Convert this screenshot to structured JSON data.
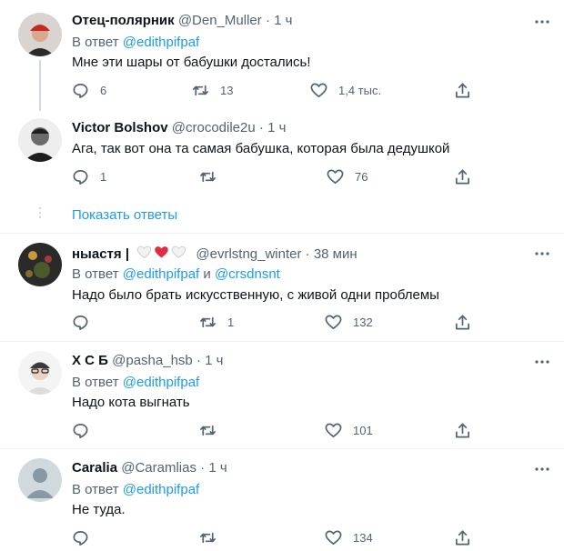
{
  "tweets": [
    {
      "name": "Отец-полярник",
      "handle": "@Den_Muller",
      "time": "1 ч",
      "reply_prefix": "В ответ",
      "reply_to": [
        "@edithpifpaf"
      ],
      "text": "Мне эти шары от бабушки достались!",
      "replies": "6",
      "retweets": "13",
      "likes": "1,4 тыс."
    },
    {
      "name": "Victor Bolshov",
      "handle": "@crocodile2u",
      "time": "1 ч",
      "text": "Ага, так вот она та самая бабушка, которая была дедушкой",
      "replies": "1",
      "retweets": "",
      "likes": "76"
    },
    {
      "name": "ныастя |",
      "name_emoji": [
        "white-heart",
        "red-heart",
        "white-heart"
      ],
      "handle": "@evrlstng_winter",
      "time": "38 мин",
      "reply_prefix": "В ответ",
      "reply_to": [
        "@edithpifpaf",
        "@crsdnsnt"
      ],
      "reply_joiner": "и",
      "text": "Надо было брать искусственную, с живой одни проблемы",
      "replies": "",
      "retweets": "1",
      "likes": "132"
    },
    {
      "name": "Х С Б",
      "handle": "@pasha_hsb",
      "time": "1 ч",
      "reply_prefix": "В ответ",
      "reply_to": [
        "@edithpifpaf"
      ],
      "text": "Надо кота выгнать",
      "replies": "",
      "retweets": "",
      "likes": "101"
    },
    {
      "name": "Caralia",
      "handle": "@Caramlias",
      "time": "1 ч",
      "reply_prefix": "В ответ",
      "reply_to": [
        "@edithpifpaf"
      ],
      "text": "Не туда.",
      "replies": "",
      "retweets": "",
      "likes": "134"
    }
  ],
  "show_more_replies": "Показать ответы",
  "separator": "·",
  "colors": {
    "link": "#1d9bf0",
    "muted": "#536471",
    "text": "#0f1419",
    "heart_red": "#e0245e",
    "divider": "#eff3f4"
  }
}
